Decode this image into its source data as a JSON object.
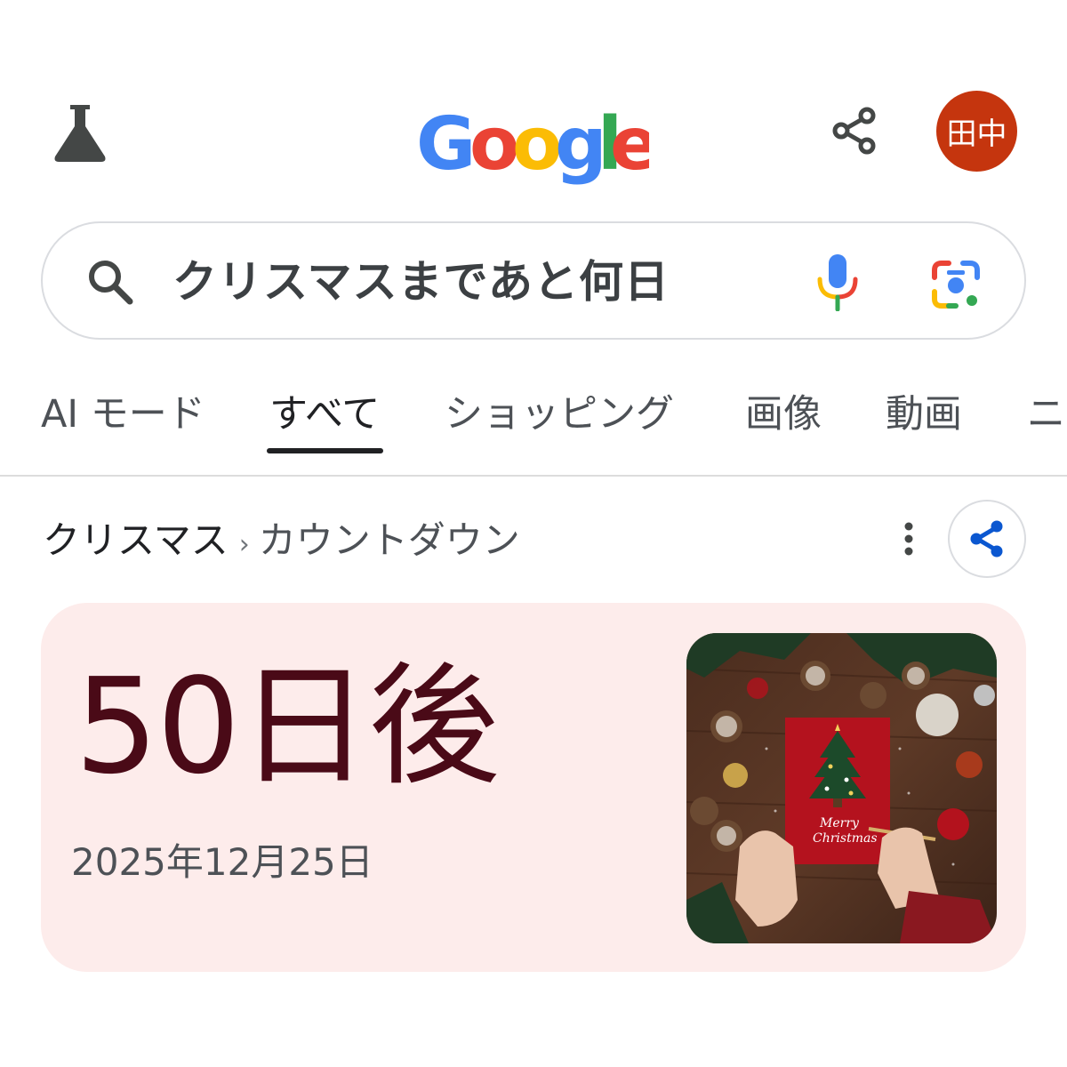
{
  "header": {
    "labs_icon": "flask-icon",
    "logo_text": "Google",
    "logo_colors": [
      "#4285F4",
      "#EA4335",
      "#FBBC05",
      "#4285F4",
      "#34A853",
      "#EA4335"
    ],
    "share_icon": "share-icon",
    "avatar_text": "田中",
    "avatar_color": "#c5350e"
  },
  "search": {
    "query": "クリスマスまであと何日",
    "search_icon": "search-icon",
    "mic_icon": "mic-icon",
    "lens_icon": "google-lens-icon"
  },
  "tabs": [
    {
      "label": "AI モード",
      "active": false
    },
    {
      "label": "すべて",
      "active": true
    },
    {
      "label": "ショッピング",
      "active": false
    },
    {
      "label": "画像",
      "active": false
    },
    {
      "label": "動画",
      "active": false
    },
    {
      "label": "ニ",
      "active": false
    }
  ],
  "result": {
    "breadcrumb_main": "クリスマス",
    "breadcrumb_separator": "›",
    "breadcrumb_sub": "カウントダウン",
    "more_icon": "more-vert-icon",
    "share_icon": "share-icon",
    "accent_color": "#0b57d0"
  },
  "countdown": {
    "days_text": "50日後",
    "date_text": "2025年12月25日",
    "card_bg": "#fdeceb",
    "days_color": "#4a0a17",
    "image_text": "Merry Christmas"
  }
}
